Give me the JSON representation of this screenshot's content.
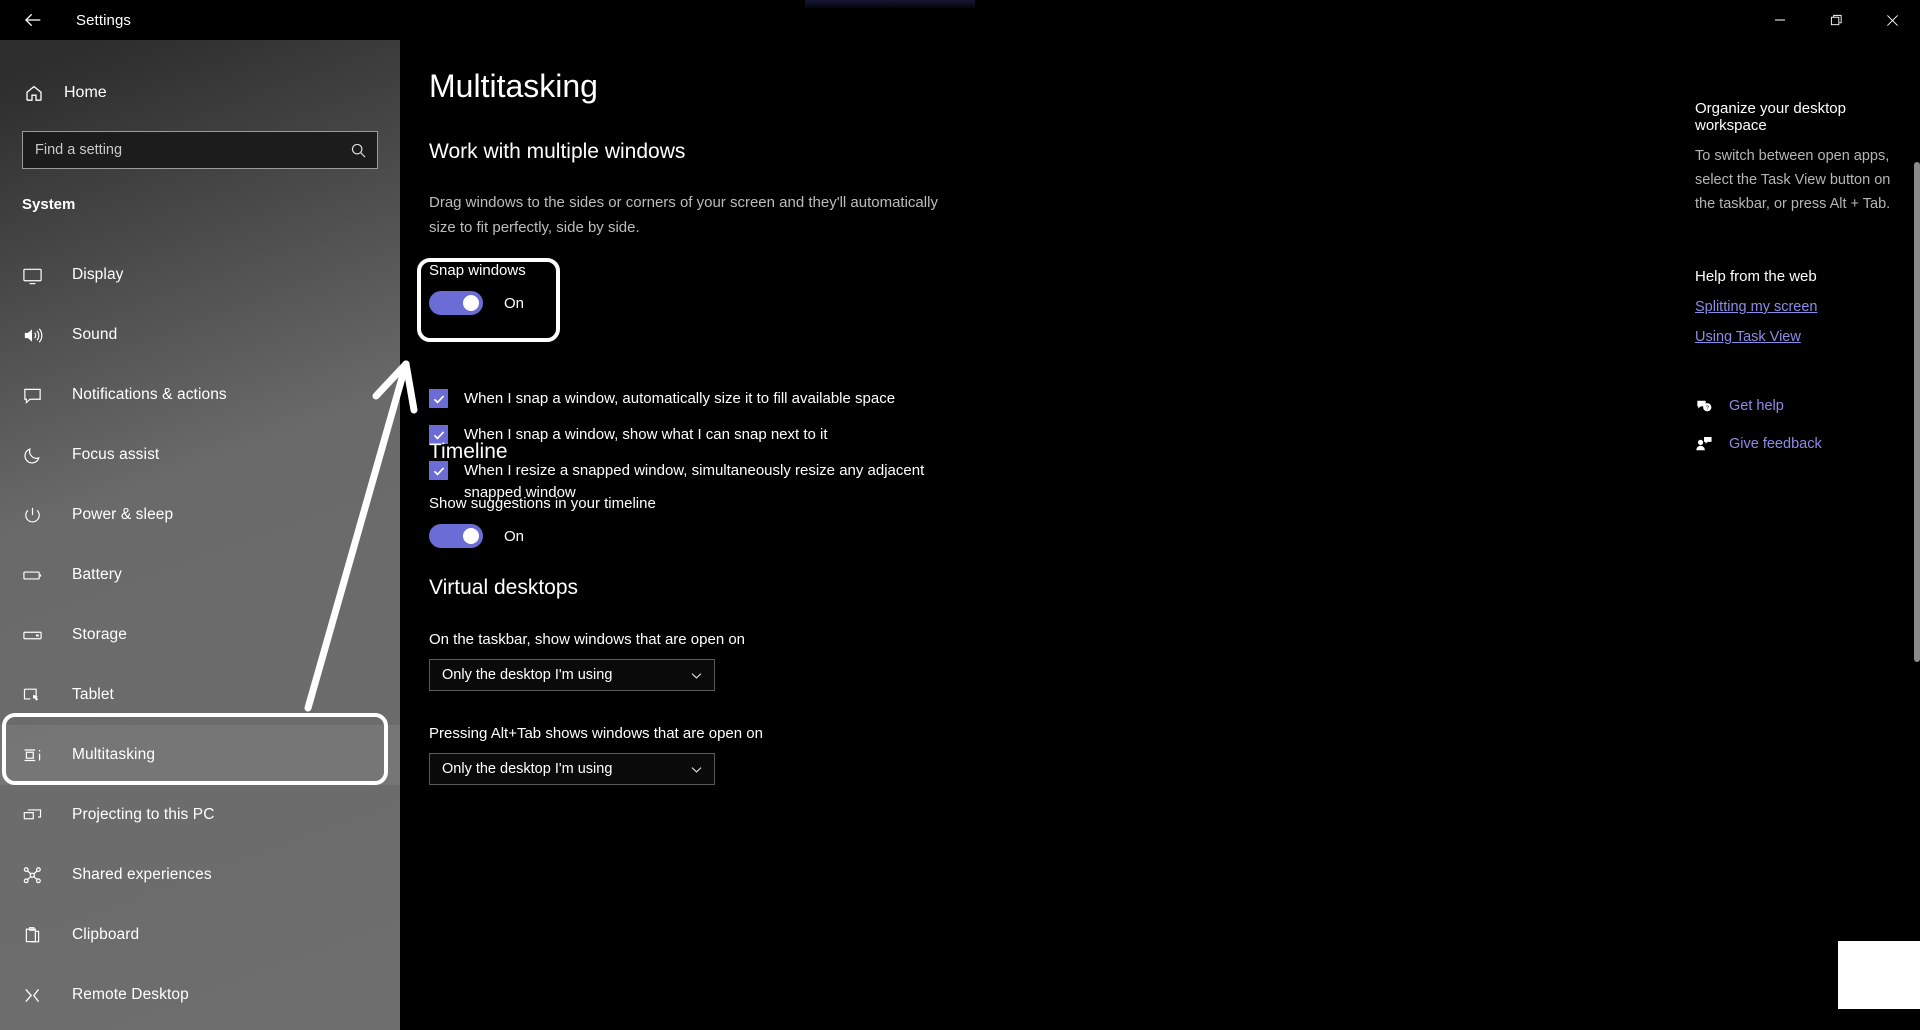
{
  "window": {
    "title": "Settings",
    "back_icon": "back-arrow-icon",
    "controls": {
      "minimize": "minimize-icon",
      "maximize": "restore-icon",
      "close": "close-icon"
    }
  },
  "sidebar": {
    "home_label": "Home",
    "home_icon": "home-icon",
    "search": {
      "placeholder": "Find a setting",
      "value": "",
      "icon": "search-icon"
    },
    "group_label": "System",
    "items": [
      {
        "label": "Display",
        "icon": "monitor-icon",
        "selected": false
      },
      {
        "label": "Sound",
        "icon": "speaker-icon",
        "selected": false
      },
      {
        "label": "Notifications & actions",
        "icon": "chat-bubble-icon",
        "selected": false
      },
      {
        "label": "Focus assist",
        "icon": "moon-icon",
        "selected": false
      },
      {
        "label": "Power & sleep",
        "icon": "power-icon",
        "selected": false
      },
      {
        "label": "Battery",
        "icon": "battery-icon",
        "selected": false
      },
      {
        "label": "Storage",
        "icon": "storage-icon",
        "selected": false
      },
      {
        "label": "Tablet",
        "icon": "tablet-icon",
        "selected": false
      },
      {
        "label": "Multitasking",
        "icon": "multitasking-icon",
        "selected": true
      },
      {
        "label": "Projecting to this PC",
        "icon": "project-icon",
        "selected": false
      },
      {
        "label": "Shared experiences",
        "icon": "share-nodes-icon",
        "selected": false
      },
      {
        "label": "Clipboard",
        "icon": "clipboard-icon",
        "selected": false
      },
      {
        "label": "Remote Desktop",
        "icon": "remote-desktop-icon",
        "selected": false
      }
    ]
  },
  "main": {
    "page_title": "Multitasking",
    "section_windows": {
      "heading": "Work with multiple windows",
      "description": "Drag windows to the sides or corners of your screen and they'll automatically size to fit perfectly, side by side.",
      "snap": {
        "label": "Snap windows",
        "state": "On",
        "checked": true
      },
      "checkboxes": [
        {
          "label": "When I snap a window, automatically size it to fill available space",
          "checked": true
        },
        {
          "label": "When I snap a window, show what I can snap next to it",
          "checked": true
        },
        {
          "label": "When I resize a snapped window, simultaneously resize any adjacent snapped window",
          "checked": true
        }
      ]
    },
    "section_timeline": {
      "heading": "Timeline",
      "toggle": {
        "label": "Show suggestions in your timeline",
        "state": "On",
        "checked": true
      }
    },
    "section_virtual_desktops": {
      "heading": "Virtual desktops",
      "fields": [
        {
          "label": "On the taskbar, show windows that are open on",
          "value": "Only the desktop I'm using"
        },
        {
          "label": "Pressing Alt+Tab shows windows that are open on",
          "value": "Only the desktop I'm using"
        }
      ]
    }
  },
  "rail": {
    "heading": "Organize your desktop workspace",
    "paragraph": "To switch between open apps, select the Task View button on the taskbar, or press Alt + Tab.",
    "help_heading": "Help from the web",
    "links": [
      "Splitting my screen",
      "Using Task View"
    ],
    "actions": [
      {
        "label": "Get help",
        "icon": "question-bubble-icon"
      },
      {
        "label": "Give feedback",
        "icon": "feedback-person-icon"
      }
    ]
  },
  "colors": {
    "accent": "#6C6CD6",
    "link": "#8c8ce8",
    "annotation": "#ffffff",
    "background": "#000000"
  }
}
